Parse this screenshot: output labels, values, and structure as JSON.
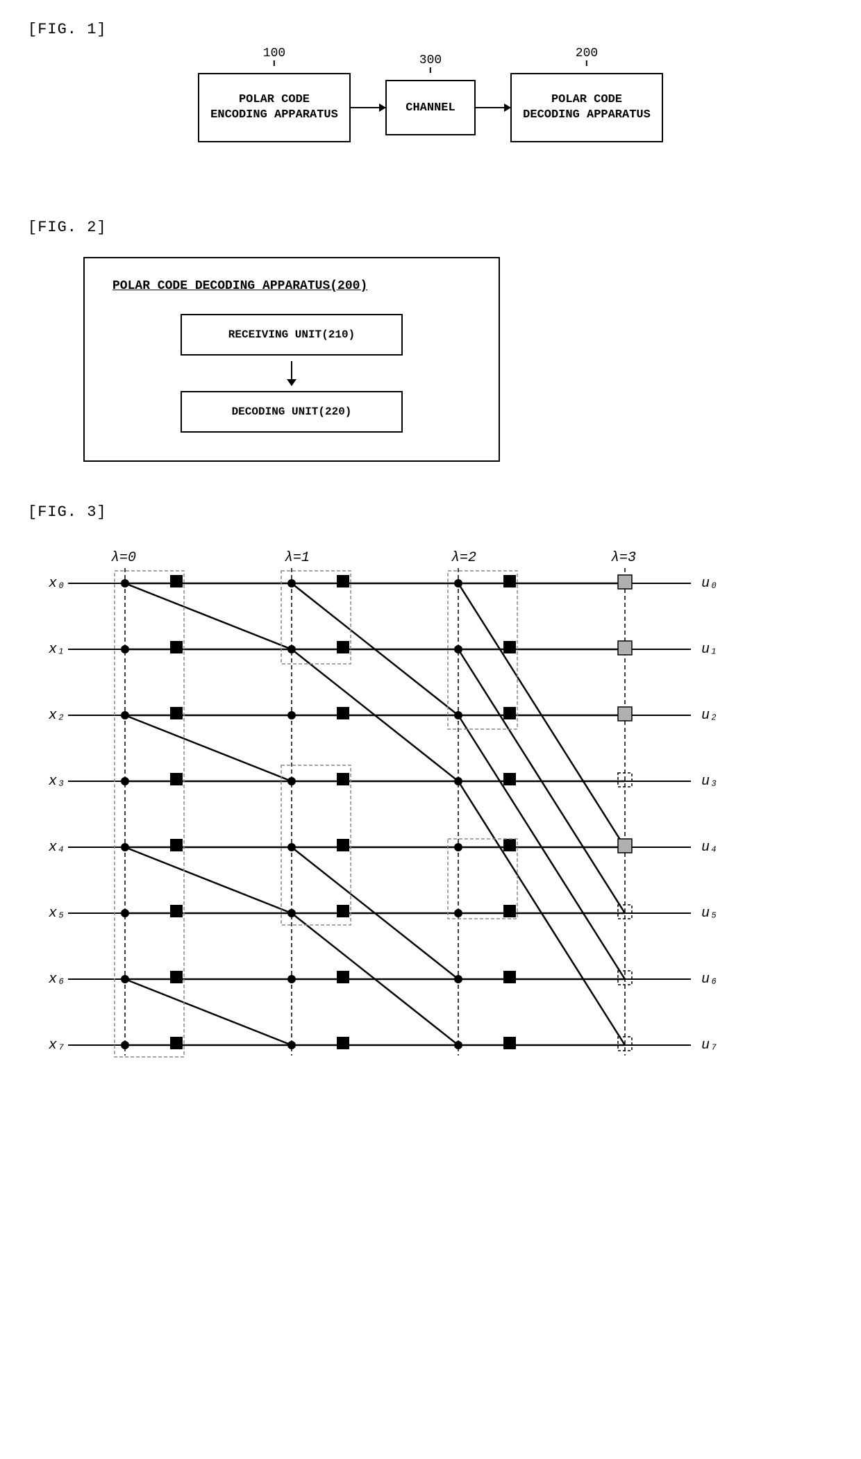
{
  "fig1": {
    "label": "[FIG. 1]",
    "encoder": {
      "id": "100",
      "text": "POLAR CODE\nENCODING APPARATUS"
    },
    "channel": {
      "id": "300",
      "text": "CHANNEL"
    },
    "decoder": {
      "id": "200",
      "text": "POLAR CODE\nDECODING APPARATUS"
    }
  },
  "fig2": {
    "label": "[FIG. 2]",
    "title": "POLAR CODE DECODING APPARATUS(200)",
    "receiving_unit": "RECEIVING UNIT(210)",
    "decoding_unit": "DECODING UNIT(220)"
  },
  "fig3": {
    "label": "[FIG. 3]",
    "lambda_labels": [
      "λ=0",
      "λ=1",
      "λ=2",
      "λ=3"
    ],
    "x_labels": [
      "x₀",
      "x₁",
      "x₂",
      "x₃",
      "x₄",
      "x₅",
      "x₆",
      "x₇"
    ],
    "u_labels": [
      "u₀",
      "u₁",
      "u₂",
      "u₃",
      "u₄",
      "u₅",
      "u₆",
      "u₇"
    ],
    "shaded_nodes": [
      0,
      1,
      2,
      4
    ],
    "frozen_nodes": [
      3,
      5,
      6,
      7
    ]
  }
}
